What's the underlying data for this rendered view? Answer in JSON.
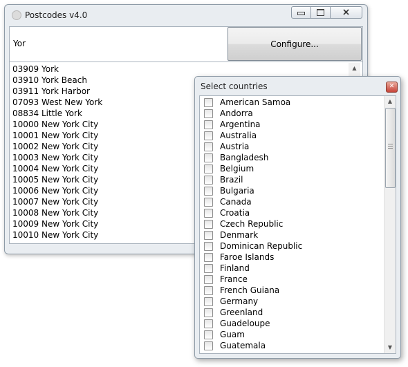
{
  "window": {
    "title": "Postcodes v4.0",
    "search_value": "Yor",
    "configure_label": "Configure...",
    "results": [
      "03909 York",
      "03910 York Beach",
      "03911 York Harbor",
      "07093 West New York",
      "08834 Little York",
      "10000 New York City",
      "10001 New York City",
      "10002 New York City",
      "10003 New York City",
      "10004 New York City",
      "10005 New York City",
      "10006 New York City",
      "10007 New York City",
      "10008 New York City",
      "10009 New York City",
      "10010 New York City"
    ]
  },
  "dialog": {
    "title": "Select countries",
    "countries": [
      "American Samoa",
      "Andorra",
      "Argentina",
      "Australia",
      "Austria",
      "Bangladesh",
      "Belgium",
      "Brazil",
      "Bulgaria",
      "Canada",
      "Croatia",
      "Czech Republic",
      "Denmark",
      "Dominican Republic",
      "Faroe Islands",
      "Finland",
      "France",
      "French Guiana",
      "Germany",
      "Greenland",
      "Guadeloupe",
      "Guam",
      "Guatemala"
    ]
  },
  "icons": {
    "app": "app-icon",
    "minimize": "minimize-icon",
    "maximize": "maximize-icon",
    "close": "close-icon",
    "scroll_up": "chevron-up-icon",
    "scroll_down": "chevron-down-icon"
  }
}
